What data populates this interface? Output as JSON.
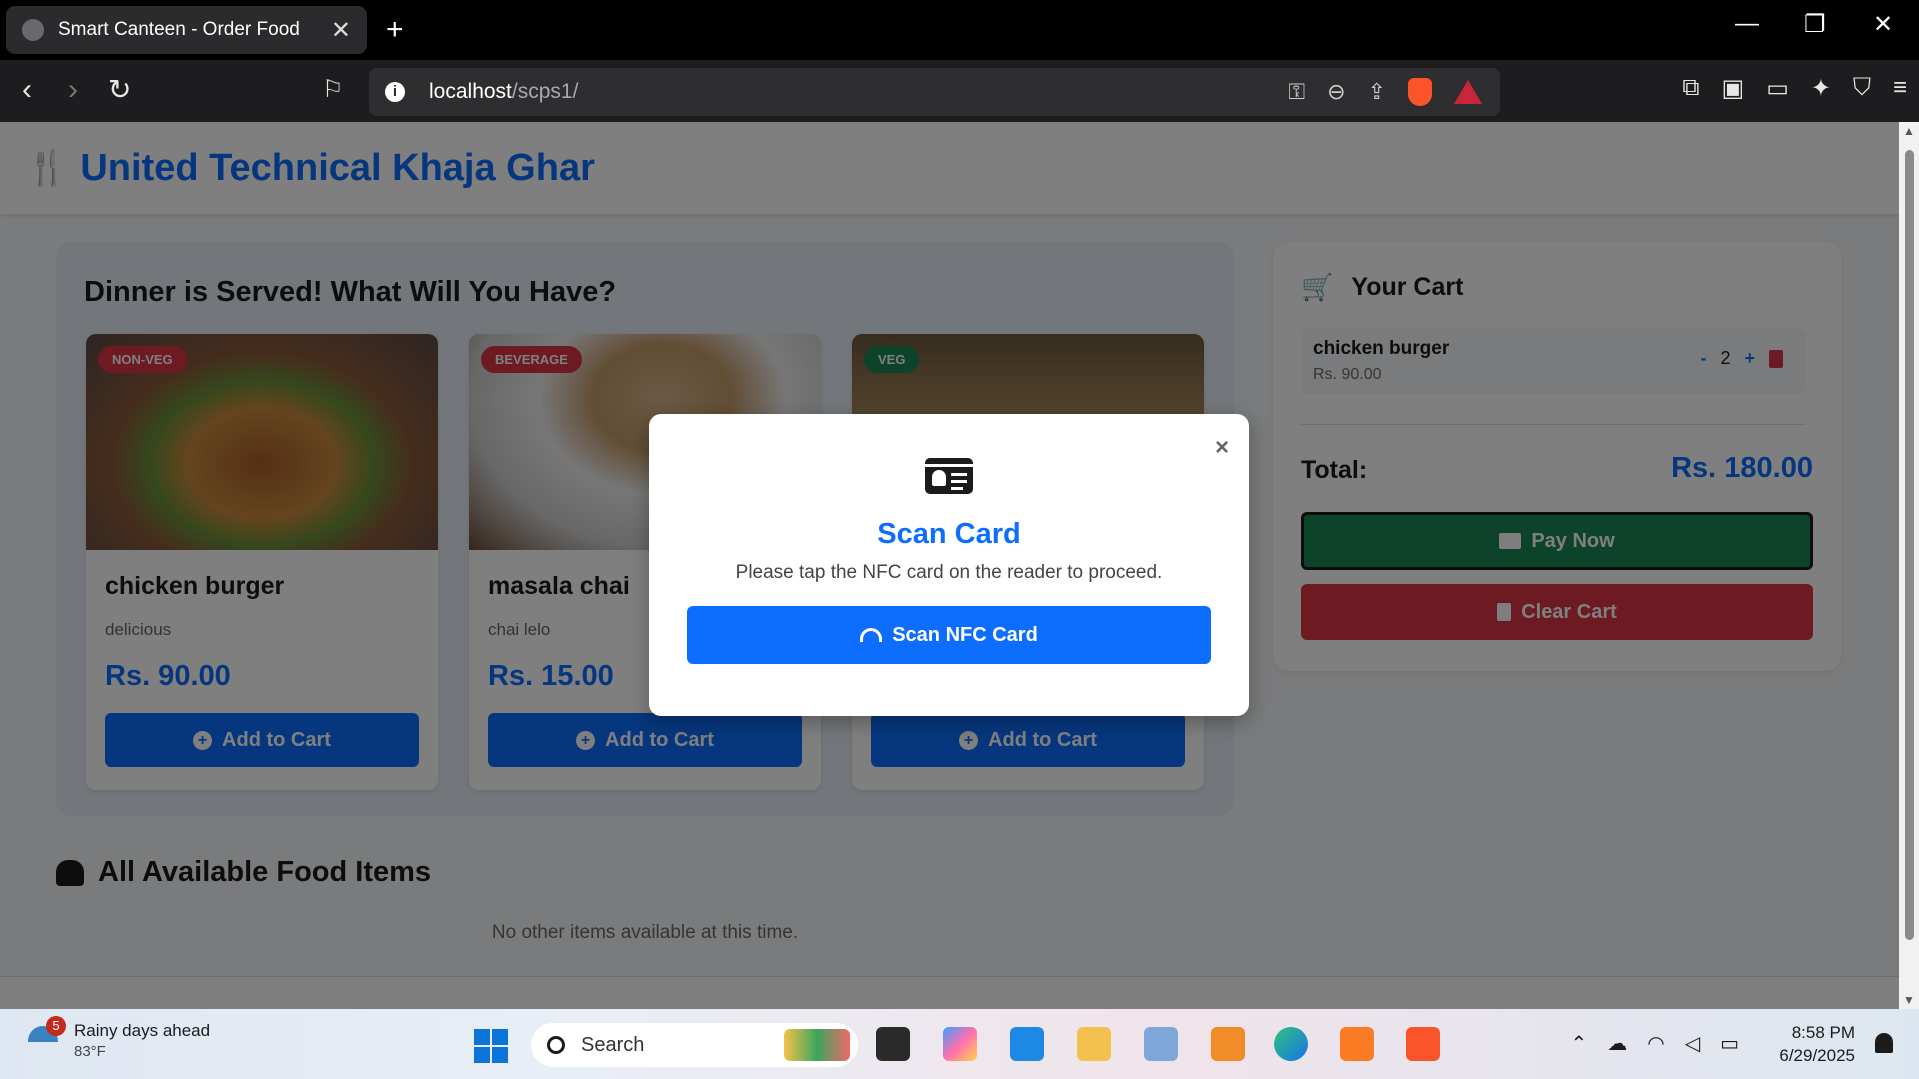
{
  "browser": {
    "tab_title": "Smart Canteen - Order Food",
    "tab_close": "✕",
    "new_tab": "+",
    "url_host": "localhost",
    "url_path": "/scps1/",
    "window_minimize": "—",
    "window_restore": "❐",
    "window_close": "✕"
  },
  "header": {
    "brand": "United Technical Khaja Ghar",
    "brand_icon": "utensils-icon"
  },
  "featured": {
    "title": "Dinner is Served! What Will You Have?",
    "items": [
      {
        "badge": "NON-VEG",
        "name": "chicken burger",
        "desc": "delicious",
        "price": "Rs. 90.00",
        "button": "Add to Cart"
      },
      {
        "badge": "BEVERAGE",
        "name": "masala chai",
        "desc": "chai lelo",
        "price": "Rs. 15.00",
        "button": "Add to Cart"
      },
      {
        "badge": "VEG",
        "name": "",
        "desc": "",
        "price": "",
        "button": "Add to Cart"
      }
    ]
  },
  "all_items": {
    "title": "All Available Food Items",
    "empty_message": "No other items available at this time."
  },
  "cart": {
    "title": "Your Cart",
    "items": [
      {
        "name": "chicken burger",
        "price": "Rs. 90.00",
        "minus": "-",
        "qty": "2",
        "plus": "+"
      }
    ],
    "total_label": "Total:",
    "total_value": "Rs. 180.00",
    "pay_button": "Pay Now",
    "clear_button": "Clear Cart"
  },
  "modal": {
    "close": "×",
    "title": "Scan Card",
    "message": "Please tap the NFC card on the reader to proceed.",
    "scan_button": "Scan NFC Card"
  },
  "taskbar": {
    "weather_badge": "5",
    "weather_title": "Rainy days ahead",
    "weather_temp": "83°F",
    "search_label": "Search",
    "time": "8:58 PM",
    "date": "6/29/2025"
  },
  "colors": {
    "primary": "#0d6efd",
    "success": "#198754",
    "danger": "#dc3545"
  }
}
